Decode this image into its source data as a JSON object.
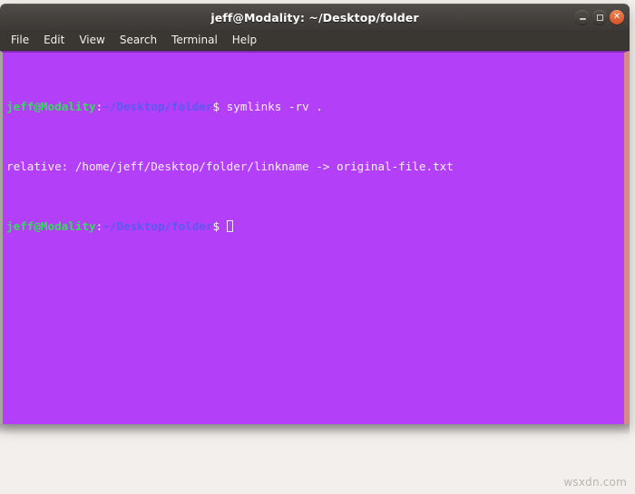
{
  "desktop": {
    "background_color": "#f2efec",
    "watermark": "wsxdn.com"
  },
  "window": {
    "title": "jeff@Modality: ~/Desktop/folder",
    "titlebar_color": "#45413e",
    "controls": [
      {
        "name": "minimize",
        "label": "–"
      },
      {
        "name": "maximize",
        "label": "□"
      },
      {
        "name": "close",
        "label": "×"
      }
    ]
  },
  "menubar": {
    "items": [
      {
        "label": "File"
      },
      {
        "label": "Edit"
      },
      {
        "label": "View"
      },
      {
        "label": "Search"
      },
      {
        "label": "Terminal"
      },
      {
        "label": "Help"
      }
    ]
  },
  "terminal": {
    "background_color": "#b43ff8",
    "prompt_user_color": "#35db5a",
    "prompt_path_color": "#5a5af0",
    "text_color": "#f4f2f6",
    "lines": [
      {
        "type": "prompt",
        "user": "jeff@Modality",
        "separator": ":",
        "path": "~/Desktop/folder",
        "sigil": "$ ",
        "command": "symlinks -rv ."
      },
      {
        "type": "output",
        "text": "relative: /home/jeff/Desktop/folder/linkname -> original-file.txt"
      },
      {
        "type": "prompt",
        "user": "jeff@Modality",
        "separator": ":",
        "path": "~/Desktop/folder",
        "sigil": "$ ",
        "command": ""
      }
    ]
  }
}
